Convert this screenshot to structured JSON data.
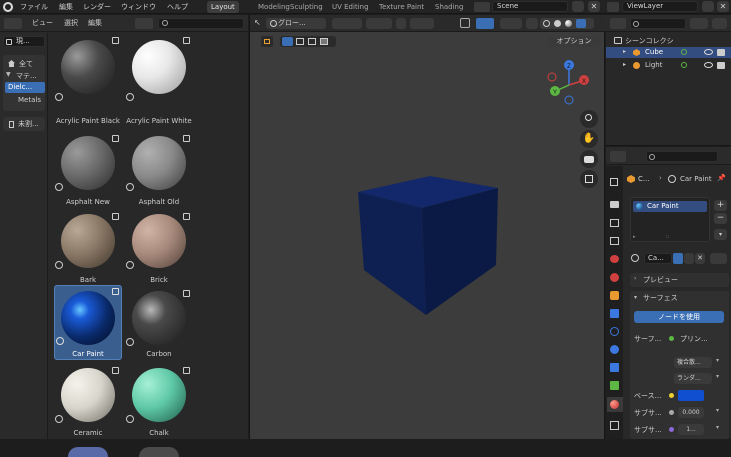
{
  "topbar": {
    "menus": [
      "ファイル",
      "編集",
      "レンダー",
      "ウィンドウ",
      "ヘルプ"
    ],
    "workspaces": [
      "Layout",
      "Modeling",
      "Sculpting",
      "UV Editing",
      "Texture Paint",
      "Shading"
    ],
    "active_workspace": "Layout",
    "scene": "Scene",
    "view_layer": "ViewLayer"
  },
  "asset_browser": {
    "menus": [
      "ビュー",
      "選択",
      "編集"
    ],
    "library": "現...",
    "sidebar": [
      "全て",
      "マテ...",
      "Dielc...",
      "Metals",
      "未割..."
    ],
    "active_category": "Dielc...",
    "materials": [
      {
        "name": "Acrylic Paint Black",
        "color": "#4a4a4a"
      },
      {
        "name": "Acrylic Paint White",
        "color": "#e8e8e8"
      },
      {
        "name": "Asphalt New",
        "color": "#6a6a6a"
      },
      {
        "name": "Asphalt Old",
        "color": "#8a8a8a"
      },
      {
        "name": "Bark",
        "color": "#8a7866"
      },
      {
        "name": "Brick",
        "color": "#a88a7c"
      },
      {
        "name": "Car Paint",
        "color": "#0a3a8a"
      },
      {
        "name": "Carbon",
        "color": "#3a3a3a"
      },
      {
        "name": "Ceramic",
        "color": "#d8d6cc"
      },
      {
        "name": "Chalk",
        "color": "#5ec8a6"
      }
    ],
    "selected": "Car Paint"
  },
  "viewport": {
    "orientation": "グロー...",
    "options": "オプション",
    "cube_color": "#0e1f52",
    "background": "#3c3c3c"
  },
  "outliner": {
    "title": "シーンコレクシ",
    "items": [
      {
        "name": "Cube",
        "selected": true
      },
      {
        "name": "Light",
        "selected": false
      }
    ]
  },
  "properties": {
    "breadcrumb_obj": "C...",
    "breadcrumb_mat": "Car Paint",
    "slot": "Car Paint",
    "mat_field": "Ca...",
    "preview": "プレビュー",
    "surface_header": "サーフェス",
    "use_nodes": "ノードを使用",
    "surface_label": "サーフ...",
    "surface_value": "プリン...",
    "multiscatter": "複合散...",
    "random": "ランダ...",
    "base_label": "ベース...",
    "base_color": "#1050d0",
    "sub1_label": "サブサ...",
    "sub1_value": "0.000",
    "sub2_label": "サブサ...",
    "sub2_value": "1..."
  }
}
